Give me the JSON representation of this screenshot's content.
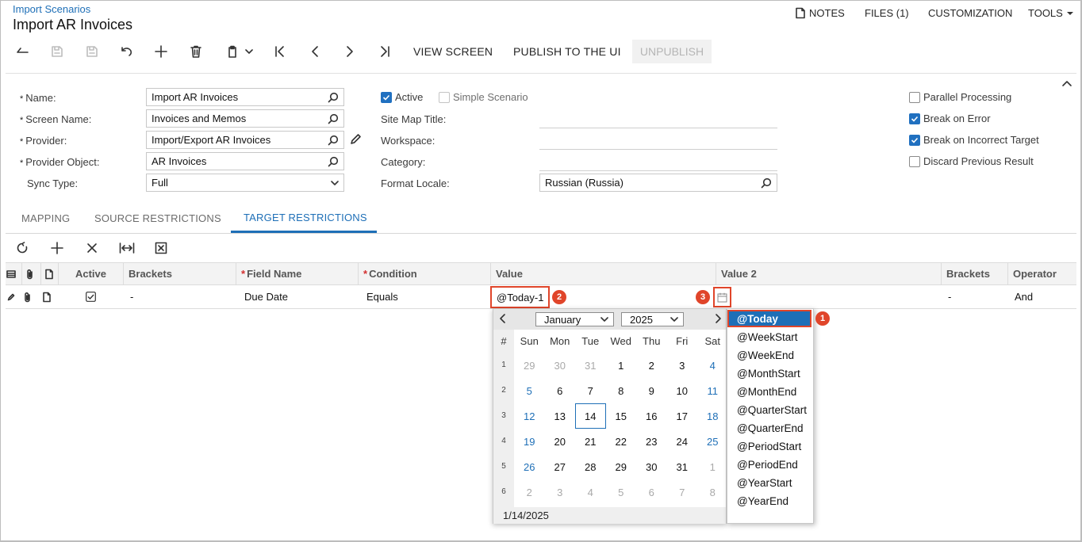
{
  "header": {
    "breadcrumb": "Import Scenarios",
    "title": "Import AR Invoices",
    "notes": "NOTES",
    "files": "FILES (1)",
    "customization": "CUSTOMIZATION",
    "tools": "TOOLS"
  },
  "toolbar": {
    "view_screen": "VIEW SCREEN",
    "publish": "PUBLISH TO THE UI",
    "unpublish": "UNPUBLISH"
  },
  "form": {
    "name_label": "Name:",
    "name_value": "Import AR Invoices",
    "screen_label": "Screen Name:",
    "screen_value": "Invoices and Memos",
    "provider_label": "Provider:",
    "provider_value": "Import/Export AR Invoices",
    "provider_object_label": "Provider Object:",
    "provider_object_value": "AR Invoices",
    "sync_label": "Sync Type:",
    "sync_value": "Full",
    "active_label": "Active",
    "active_checked": true,
    "simple_label": "Simple Scenario",
    "simple_checked": false,
    "sitemap_label": "Site Map Title:",
    "workspace_label": "Workspace:",
    "category_label": "Category:",
    "locale_label": "Format Locale:",
    "locale_value": "Russian (Russia)",
    "parallel_label": "Parallel Processing",
    "parallel_checked": false,
    "break_error_label": "Break on Error",
    "break_error_checked": true,
    "break_target_label": "Break on Incorrect Target",
    "break_target_checked": true,
    "discard_label": "Discard Previous Result",
    "discard_checked": false
  },
  "tabs": [
    "MAPPING",
    "SOURCE RESTRICTIONS",
    "TARGET RESTRICTIONS"
  ],
  "grid": {
    "headers": {
      "active": "Active",
      "brackets": "Brackets",
      "field_name": "Field Name",
      "condition": "Condition",
      "value": "Value",
      "value2": "Value 2",
      "brackets2": "Brackets",
      "operator": "Operator"
    },
    "row": {
      "active": true,
      "brackets": "-",
      "field_name": "Due Date",
      "condition": "Equals",
      "value": "@Today-1",
      "brackets2": "-",
      "operator": "And"
    }
  },
  "callouts": [
    "1",
    "2",
    "3"
  ],
  "calendar": {
    "month": "January",
    "year": "2025",
    "weekday_header": [
      "#",
      "Sun",
      "Mon",
      "Tue",
      "Wed",
      "Thu",
      "Fri",
      "Sat"
    ],
    "weeks": [
      {
        "n": "1",
        "days": [
          "29",
          "30",
          "31",
          "1",
          "2",
          "3",
          "4"
        ]
      },
      {
        "n": "2",
        "days": [
          "5",
          "6",
          "7",
          "8",
          "9",
          "10",
          "11"
        ]
      },
      {
        "n": "3",
        "days": [
          "12",
          "13",
          "14",
          "15",
          "16",
          "17",
          "18"
        ]
      },
      {
        "n": "4",
        "days": [
          "19",
          "20",
          "21",
          "22",
          "23",
          "24",
          "25"
        ]
      },
      {
        "n": "5",
        "days": [
          "26",
          "27",
          "28",
          "29",
          "30",
          "31",
          "1"
        ]
      },
      {
        "n": "6",
        "days": [
          "2",
          "3",
          "4",
          "5",
          "6",
          "7",
          "8"
        ]
      }
    ],
    "today_day": "14",
    "footer_date": "1/14/2025"
  },
  "relative_dates": [
    "@Today",
    "@WeekStart",
    "@WeekEnd",
    "@MonthStart",
    "@MonthEnd",
    "@QuarterStart",
    "@QuarterEnd",
    "@PeriodStart",
    "@PeriodEnd",
    "@YearStart",
    "@YearEnd"
  ],
  "colors": {
    "accent": "#1e6fb7",
    "callout": "#e0452a"
  }
}
